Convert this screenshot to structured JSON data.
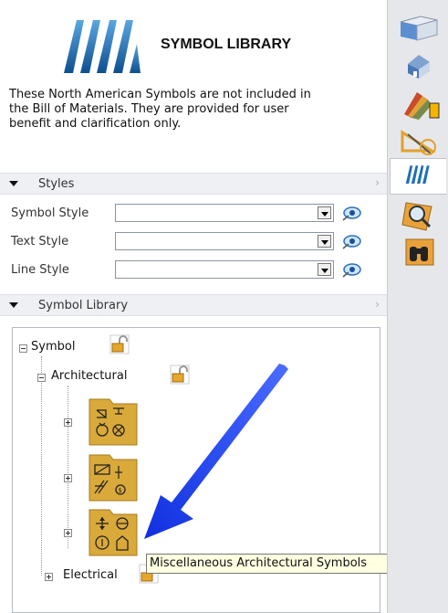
{
  "header": {
    "title": "SYMBOL LIBRARY",
    "description": "These North American Symbols are not included in the Bill of Materials. They are provided for user benefit and clarification only."
  },
  "styles": {
    "section_label": "Styles",
    "rows": [
      {
        "label": "Symbol Style",
        "value": ""
      },
      {
        "label": "Text Style",
        "value": ""
      },
      {
        "label": "Line Style",
        "value": ""
      }
    ]
  },
  "library": {
    "section_label": "Symbol Library",
    "root_label": "Symbol",
    "architectural_label": "Architectural",
    "electrical_label": "Electrical",
    "tooltip": "Miscellaneous Architectural Symbols"
  },
  "colors": {
    "accent_blue": "#1f6fb5",
    "folder_gold": "#d9a93a",
    "arrow_blue": "#1a3ff0"
  }
}
